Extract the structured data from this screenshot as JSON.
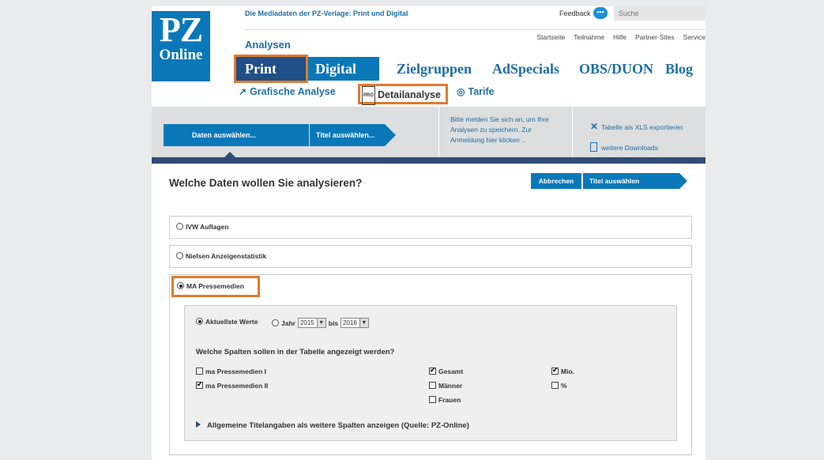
{
  "logo": {
    "line1": "PZ",
    "line2": "Online"
  },
  "header": {
    "tagline": "Die Mediadaten der PZ-Verlage: Print und Digital",
    "feedback": "Feedback",
    "search_placeholder": "Suche",
    "section": "Analysen"
  },
  "topnav": [
    "Startseite",
    "Teilnahme",
    "Hilfe",
    "Partner-Sites",
    "Service"
  ],
  "mainnav": {
    "print": "Print",
    "digital": "Digital",
    "zielgruppen": "Zielgruppen",
    "adspecials": "AdSpecials",
    "obs": "OBS/DUON",
    "blog": "Blog"
  },
  "subnav": {
    "grafische": "Grafische Analyse",
    "pro_badge": "PRO",
    "detail": "Detailanalyse",
    "tarife": "Tarife"
  },
  "steps": {
    "step1": "Daten auswählen...",
    "step2": "Titel auswählen...",
    "login_line1": "Bitte melden Sie sich an, um Ihre",
    "login_line2": "Analysen zu speichern. Zur",
    "login_line3": "Anmeldung hier klicken ..",
    "xls": "Tabelle als XLS exportieren",
    "downloads": "weitere Downloads"
  },
  "content": {
    "question": "Welche Daten wollen Sie analysieren?",
    "btn_abbrechen": "Abbrechen",
    "btn_titel": "Titel auswählen",
    "opt_ivw": "IVW Auflagen",
    "opt_nielsen": "Nielsen Anzeigenstatistik",
    "opt_ma": "MA Pressemedien",
    "aktuellste": "Aktuellste Werte",
    "jahr": "Jahr",
    "year_from": "2015",
    "bis": "bis",
    "year_to": "2016",
    "spalten_question": "Welche Spalten sollen in der Tabelle angezeigt werden?",
    "cb_ma1": "ma Pressemedien I",
    "cb_ma2": "ma Pressemedien II",
    "cb_gesamt": "Gesamt",
    "cb_maenner": "Männer",
    "cb_frauen": "Frauen",
    "cb_mio": "Mio.",
    "cb_pct": "%",
    "allgemeine": "Allgemeine Titelangaben als weitere Spalten anzeigen (Quelle: PZ-Online)"
  }
}
